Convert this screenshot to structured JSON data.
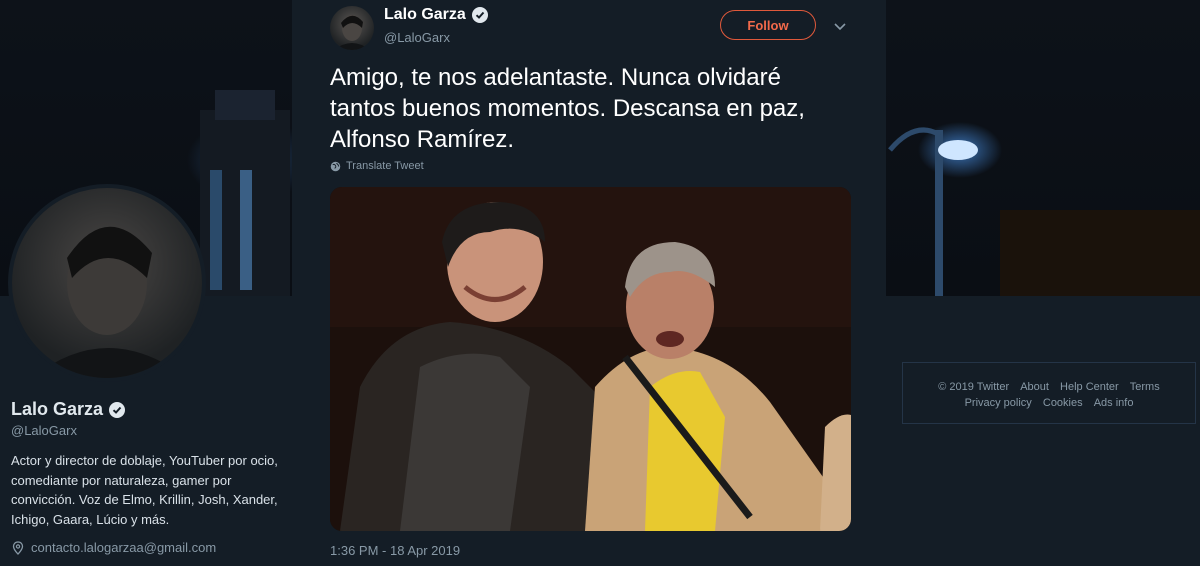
{
  "profile": {
    "name": "Lalo Garza",
    "handle": "@LaloGarx",
    "bio": "Actor y director de doblaje, YouTuber por ocio, comediante por naturaleza, gamer por convicción. Voz de Elmo, Krillin, Josh, Xander, Ichigo, Gaara, Lúcio y más.",
    "contact": "contacto.lalogarzaa@gmail.com"
  },
  "tweet": {
    "author_name": "Lalo Garza",
    "author_handle": "@LaloGarx",
    "follow_label": "Follow",
    "text": "Amigo, te nos adelantaste. Nunca olvidaré tantos buenos momentos. Descansa en paz, Alfonso Ramírez.",
    "translate_label": "Translate Tweet",
    "timestamp": "1:36 PM - 18 Apr 2019"
  },
  "footer": {
    "copyright": "© 2019 Twitter",
    "about": "About",
    "help_center": "Help Center",
    "terms": "Terms",
    "privacy": "Privacy policy",
    "cookies": "Cookies",
    "ads_info": "Ads info"
  },
  "colors": {
    "accent": "#f26a4b",
    "background": "#141d26",
    "muted_text": "#8899a6"
  },
  "icons": [
    "verified-icon",
    "chevron-down-icon",
    "globe-icon",
    "location-icon"
  ]
}
